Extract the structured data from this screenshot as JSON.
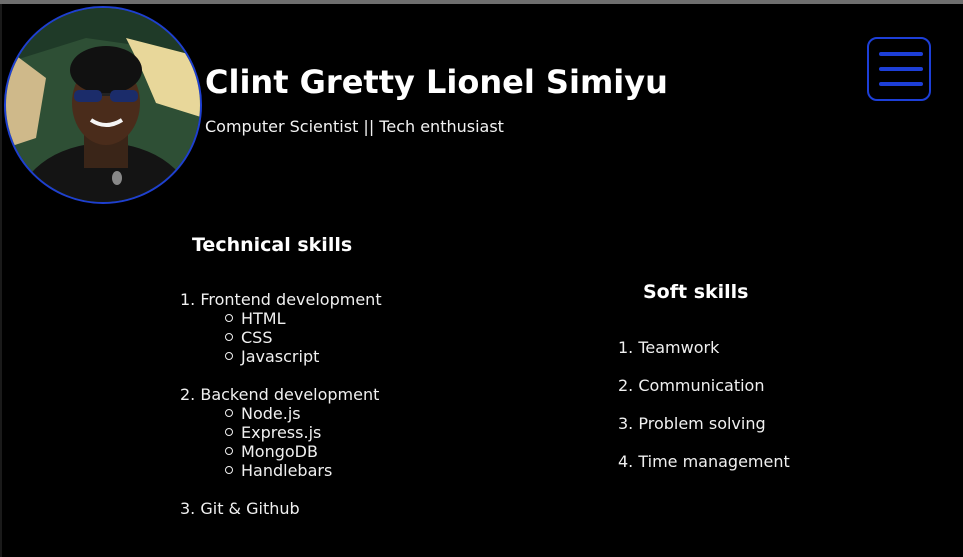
{
  "profile": {
    "name": "Clint Gretty Lionel Simiyu",
    "tagline": "Computer Scientist || Tech enthusiast"
  },
  "menu": {
    "icon": "hamburger-menu-icon"
  },
  "technical": {
    "title": "Technical skills",
    "items": [
      {
        "label": "1. Frontend development",
        "sub": [
          "HTML",
          "CSS",
          "Javascript"
        ]
      },
      {
        "label": "2. Backend development",
        "sub": [
          "Node.js",
          "Express.js",
          "MongoDB",
          "Handlebars"
        ]
      },
      {
        "label": "3. Git & Github",
        "sub": []
      }
    ]
  },
  "soft": {
    "title": "Soft skills",
    "items": [
      "1. Teamwork",
      "2. Communication",
      "3. Problem solving",
      "4. Time management"
    ]
  },
  "colors": {
    "background": "#000000",
    "accent": "#1d3fd8",
    "text": "#ffffff"
  }
}
